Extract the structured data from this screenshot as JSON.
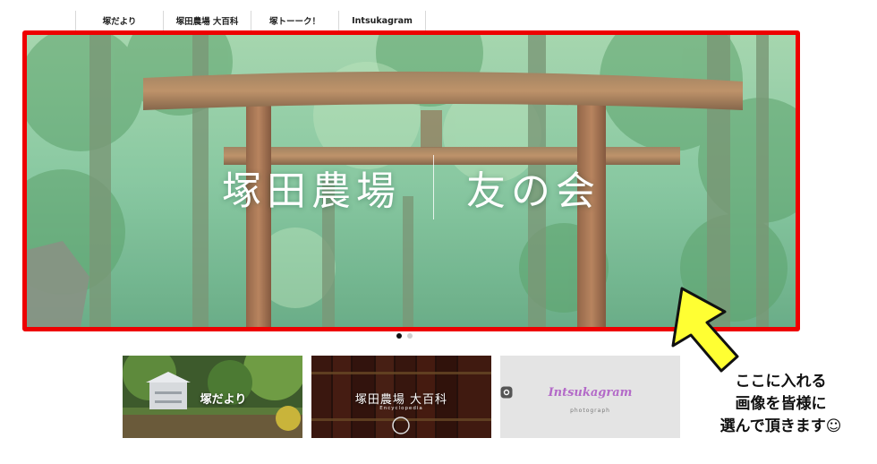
{
  "nav": {
    "items": [
      {
        "label": "塚だより"
      },
      {
        "label": "塚田農場 大百科"
      },
      {
        "label": "塚トーーク！"
      },
      {
        "label": "Intsukagram"
      }
    ]
  },
  "hero": {
    "title_left": "塚田農場",
    "title_right": "友の会",
    "slide_count": 2,
    "active_slide": 1
  },
  "cards": [
    {
      "label": "塚だより",
      "sub": ""
    },
    {
      "label": "塚田農場 大百科",
      "sub": "Encyclopedia"
    },
    {
      "label": "Intsukagram",
      "sub": "photograph"
    }
  ],
  "annotation": {
    "line1": "ここに入れる",
    "line2": "画像を皆様に",
    "line3": "選んで頂きます☺"
  },
  "colors": {
    "highlight_border": "#ee0000",
    "arrow_fill": "#ffff33",
    "instagram_accent": "#b36ac8"
  }
}
